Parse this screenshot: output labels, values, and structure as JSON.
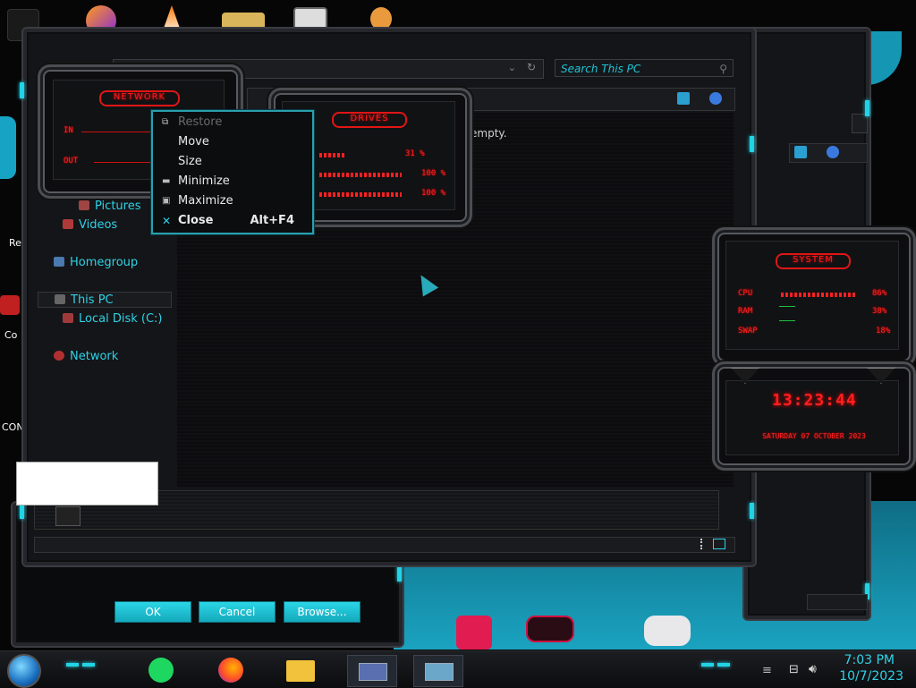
{
  "explorer": {
    "search_placeholder": "Search This PC",
    "empty_message": "empty.",
    "nav": {
      "pictures": "Pictures",
      "videos": "Videos",
      "homegroup": "Homegroup",
      "this_pc": "This PC",
      "local_disk": "Local Disk (C:)",
      "network": "Network"
    }
  },
  "context_menu": {
    "items": [
      {
        "label": "Restore",
        "shortcut": "",
        "enabled": false,
        "icon": "restore-icon"
      },
      {
        "label": "Move",
        "shortcut": "",
        "enabled": true,
        "icon": ""
      },
      {
        "label": "Size",
        "shortcut": "",
        "enabled": true,
        "icon": ""
      },
      {
        "label": "Minimize",
        "shortcut": "",
        "enabled": true,
        "icon": "minimize-icon"
      },
      {
        "label": "Maximize",
        "shortcut": "",
        "enabled": true,
        "icon": "maximize-icon"
      },
      {
        "label": "Close",
        "shortcut": "Alt+F4",
        "enabled": true,
        "icon": "close-icon"
      }
    ]
  },
  "gadgets": {
    "network": {
      "title": "NETWORK",
      "in_label": "IN",
      "out_label": "OUT"
    },
    "drives": {
      "title": "DRIVES",
      "values": [
        "31 %",
        "100 %",
        "100 %"
      ],
      "fill": [
        0.31,
        1.0,
        1.0
      ]
    },
    "system": {
      "title": "SYSTEM",
      "cpu_label": "CPU",
      "cpu_value": "86%",
      "cpu_fill": 0.86,
      "ram_label": "RAM",
      "ram_value": "38%",
      "swap_label": "SWAP",
      "swap_value": "18%"
    },
    "clock": {
      "time": "13:23:44",
      "date": "SATURDAY 07 OCTOBER 2023"
    }
  },
  "dialog": {
    "ok": "OK",
    "cancel": "Cancel",
    "browse": "Browse..."
  },
  "taskbar": {
    "time": "7:03 PM",
    "date": "10/7/2023"
  },
  "desktop_labels": {
    "label_1": "Re",
    "label_2": "Co",
    "label_3": "CON"
  },
  "colors": {
    "accent": "#22d3e6",
    "gadget_red": "#ff1c1c",
    "background": "#060606"
  }
}
